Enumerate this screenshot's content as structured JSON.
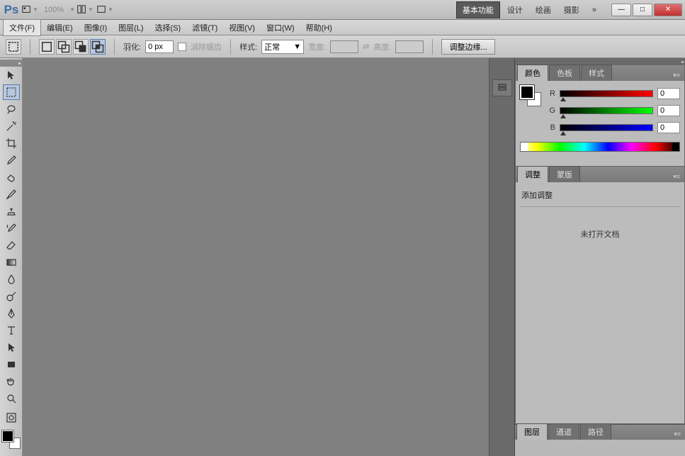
{
  "titlebar": {
    "zoom": "100%",
    "workspaces": [
      "基本功能",
      "设计",
      "绘画",
      "摄影"
    ],
    "active_workspace": 0,
    "more": "»"
  },
  "menu": {
    "items": [
      "文件(F)",
      "编辑(E)",
      "图像(I)",
      "图层(L)",
      "选择(S)",
      "滤镜(T)",
      "视图(V)",
      "窗口(W)",
      "帮助(H)"
    ]
  },
  "options": {
    "feather_label": "羽化:",
    "feather_value": "0 px",
    "antialias_label": "消除锯齿",
    "style_label": "样式:",
    "style_value": "正常",
    "width_label": "宽度:",
    "height_label": "高度:",
    "swap_icon": "⇄",
    "refine_label": "调整边缘..."
  },
  "tools": [
    "move",
    "marquee",
    "lasso",
    "wand",
    "crop",
    "eyedropper",
    "healing",
    "brush",
    "stamp",
    "history-brush",
    "eraser",
    "gradient",
    "blur",
    "dodge",
    "pen",
    "type",
    "path-select",
    "shape",
    "hand",
    "zoom"
  ],
  "active_tool": 1,
  "panels": {
    "color": {
      "tabs": [
        "颜色",
        "色板",
        "样式"
      ],
      "active": 0,
      "channels": [
        {
          "label": "R",
          "value": "0"
        },
        {
          "label": "G",
          "value": "0"
        },
        {
          "label": "B",
          "value": "0"
        }
      ]
    },
    "adjustments": {
      "tabs": [
        "调整",
        "蒙版"
      ],
      "active": 0,
      "title": "添加调整",
      "message": "未打开文档"
    },
    "bottom": {
      "tabs": [
        "图层",
        "通道",
        "路径"
      ],
      "active": 0
    }
  },
  "colors": {
    "foreground": "#000000",
    "background": "#ffffff"
  }
}
